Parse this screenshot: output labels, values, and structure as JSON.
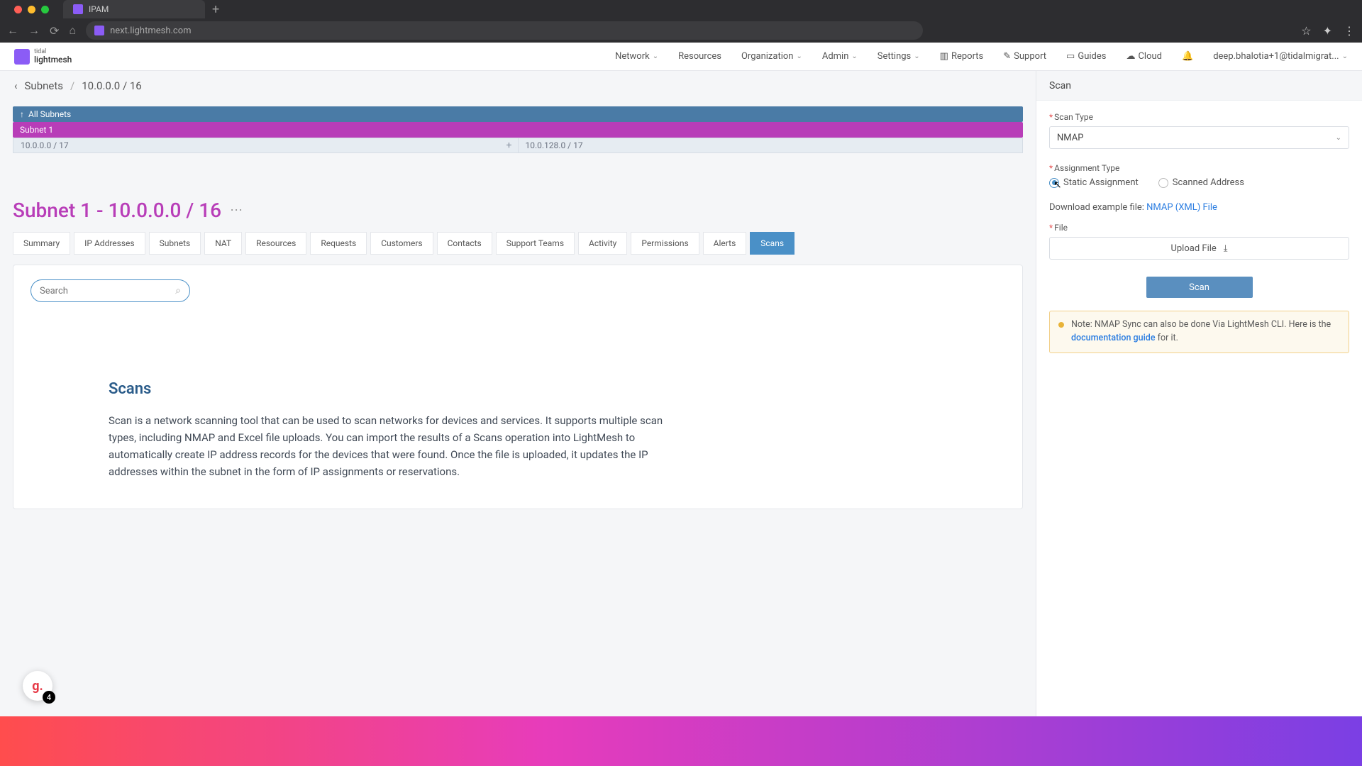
{
  "browser": {
    "tab_title": "IPAM",
    "url": "next.lightmesh.com"
  },
  "header": {
    "logo_top": "tidal",
    "logo_bottom": "lightmesh",
    "nav": [
      "Network",
      "Resources",
      "Organization",
      "Admin",
      "Settings"
    ],
    "nav_icons": [
      {
        "label": "Reports"
      },
      {
        "label": "Support"
      },
      {
        "label": "Guides"
      },
      {
        "label": "Cloud"
      }
    ],
    "user_email": "deep.bhalotia+1@tidalmigrat..."
  },
  "breadcrumb": {
    "back": "Subnets",
    "current": "10.0.0.0 / 16"
  },
  "tree": {
    "all": "All Subnets",
    "subnet1": "Subnet 1",
    "half1": "10.0.0.0 / 17",
    "half2": "10.0.128.0 / 17"
  },
  "title": "Subnet 1 - 10.0.0.0 / 16",
  "tabs": [
    "Summary",
    "IP Addresses",
    "Subnets",
    "NAT",
    "Resources",
    "Requests",
    "Customers",
    "Contacts",
    "Support Teams",
    "Activity",
    "Permissions",
    "Alerts",
    "Scans"
  ],
  "active_tab": "Scans",
  "search_placeholder": "Search",
  "scans": {
    "heading": "Scans",
    "body": "Scan is a network scanning tool that can be used to scan networks for devices and services. It supports multiple scan types, including NMAP and Excel file uploads. You can import the results of a Scans operation into LightMesh to automatically create IP address records for the devices that were found. Once the file is uploaded, it updates the IP addresses within the subnet in the form of IP assignments or reservations."
  },
  "side": {
    "title": "Scan",
    "scan_type_label": "Scan Type",
    "scan_type_value": "NMAP",
    "assignment_label": "Assignment Type",
    "assignment_opt1": "Static Assignment",
    "assignment_opt2": "Scanned Address",
    "download_prefix": "Download example file:",
    "download_link": "NMAP (XML) File",
    "file_label": "File",
    "upload_label": "Upload File",
    "scan_button": "Scan",
    "note_prefix": "Note: NMAP Sync can also be done Via LightMesh CLI. Here is the ",
    "note_link": "documentation guide",
    "note_suffix": " for it."
  },
  "float_badge": {
    "letter": "g.",
    "count": "4"
  }
}
